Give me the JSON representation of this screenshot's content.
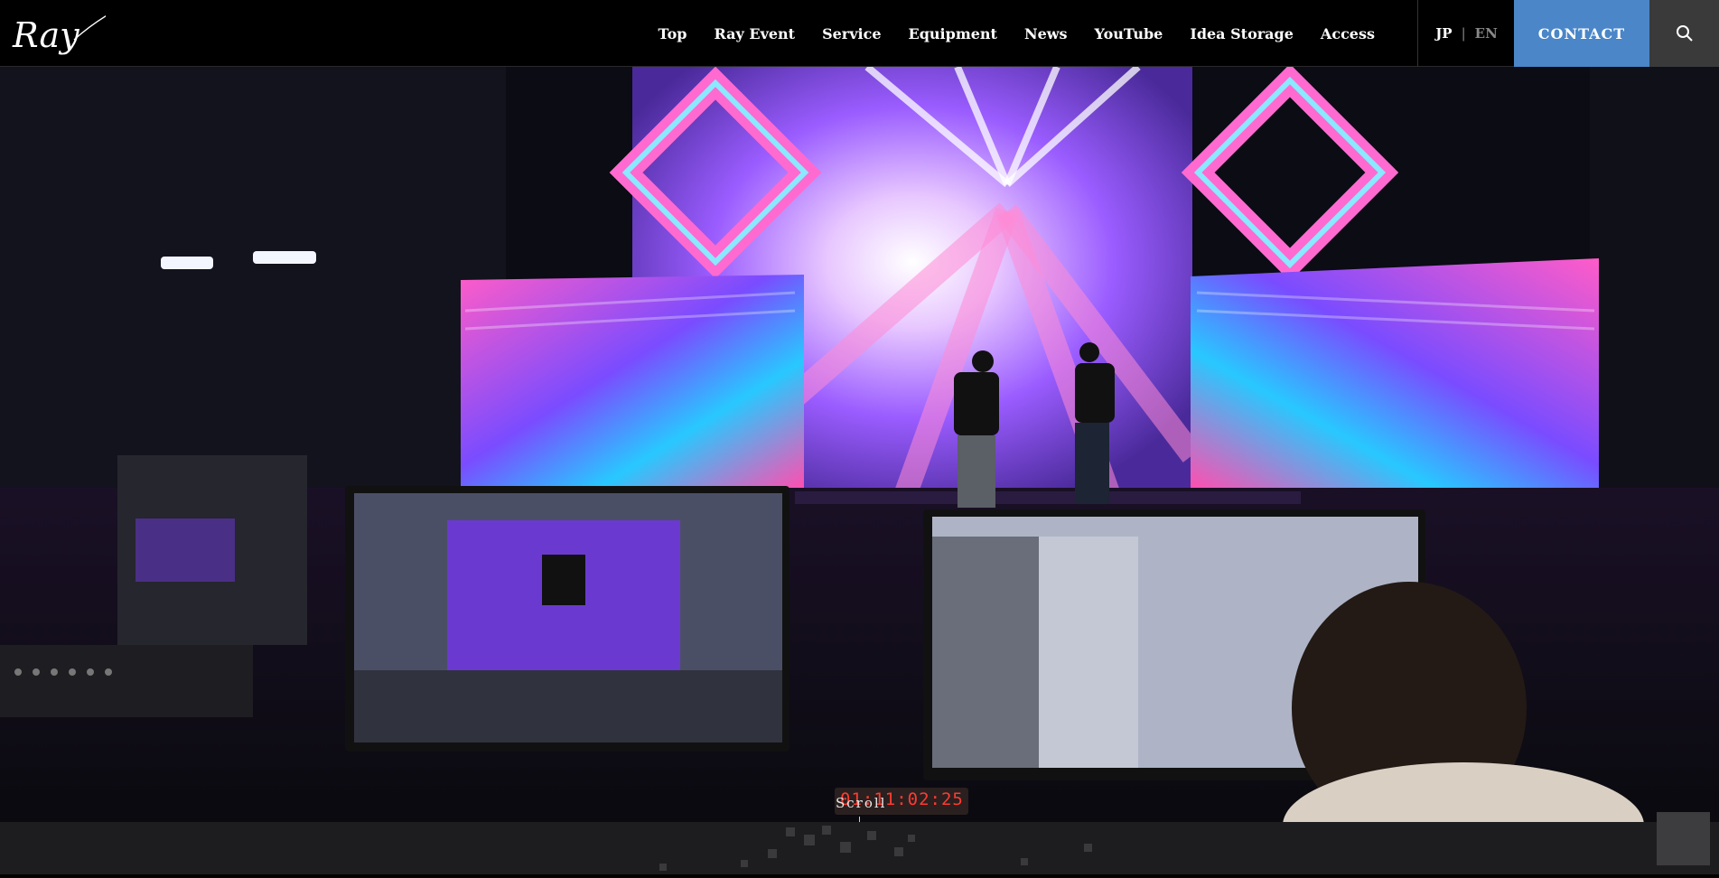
{
  "brand": {
    "logo_text": "Ray"
  },
  "nav": {
    "items": [
      "Top",
      "Ray Event",
      "Service",
      "Equipment",
      "News",
      "YouTube",
      "Idea Storage",
      "Access"
    ]
  },
  "lang": {
    "jp": "JP",
    "sep": "|",
    "en": "EN"
  },
  "contact_label": "CONTACT",
  "hero": {
    "scroll_label": "Scroll",
    "timecode": "01:11:02:25"
  },
  "colors": {
    "header_bg": "#000000",
    "contact_bg": "#4a86c8",
    "search_bg": "#3a3a3a",
    "stage_purple": "#8a4dff",
    "stage_pink": "#ff4fb0",
    "stage_cyan": "#33e0ff"
  },
  "icons": {
    "search": "search-icon"
  }
}
